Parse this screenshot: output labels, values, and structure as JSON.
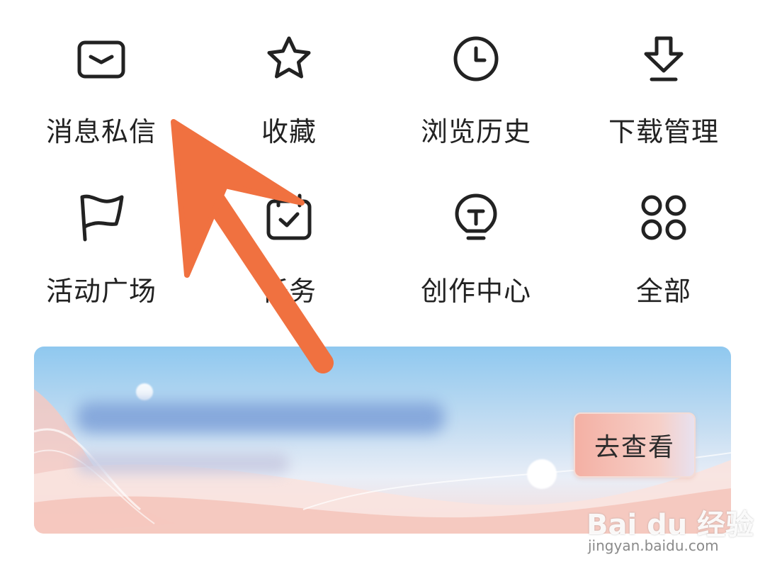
{
  "shortcuts": {
    "row1": [
      {
        "label": "消息私信",
        "icon": "envelope-icon"
      },
      {
        "label": "收藏",
        "icon": "star-icon"
      },
      {
        "label": "浏览历史",
        "icon": "clock-icon"
      },
      {
        "label": "下载管理",
        "icon": "download-icon"
      }
    ],
    "row2": [
      {
        "label": "活动广场",
        "icon": "flag-icon"
      },
      {
        "label": "任务",
        "icon": "calendar-check-icon"
      },
      {
        "label": "创作中心",
        "icon": "lightbulb-icon"
      },
      {
        "label": "全部",
        "icon": "grid-circles-icon"
      }
    ]
  },
  "banner": {
    "cta_label": "去查看"
  },
  "watermark": {
    "brand": "Bai du 经验",
    "url": "jingyan.baidu.com"
  },
  "colors": {
    "arrow": "#f07140",
    "icon_stroke": "#222222"
  }
}
